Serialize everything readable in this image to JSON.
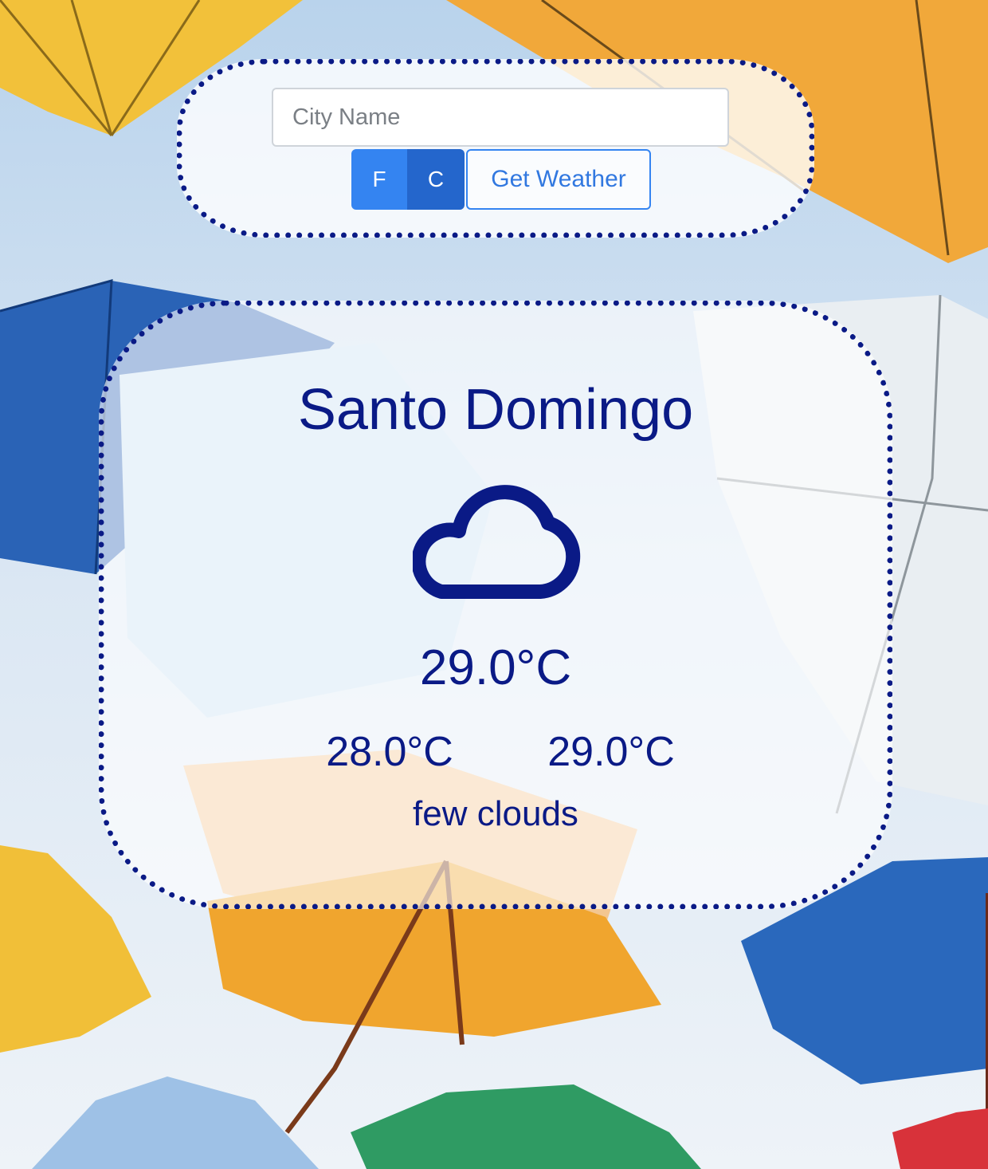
{
  "search": {
    "placeholder": "City Name",
    "value": "",
    "unit_f_label": "F",
    "unit_c_label": "C",
    "selected_unit": "C",
    "submit_label": "Get Weather"
  },
  "weather": {
    "city": "Santo Domingo",
    "icon": "cloud-icon",
    "temp": "29.0°C",
    "temp_min": "28.0°C",
    "temp_max": "29.0°C",
    "description": "few clouds"
  },
  "colors": {
    "accent": "#0a1a86",
    "button_primary": "#3484f1",
    "button_active": "#2466cc"
  }
}
